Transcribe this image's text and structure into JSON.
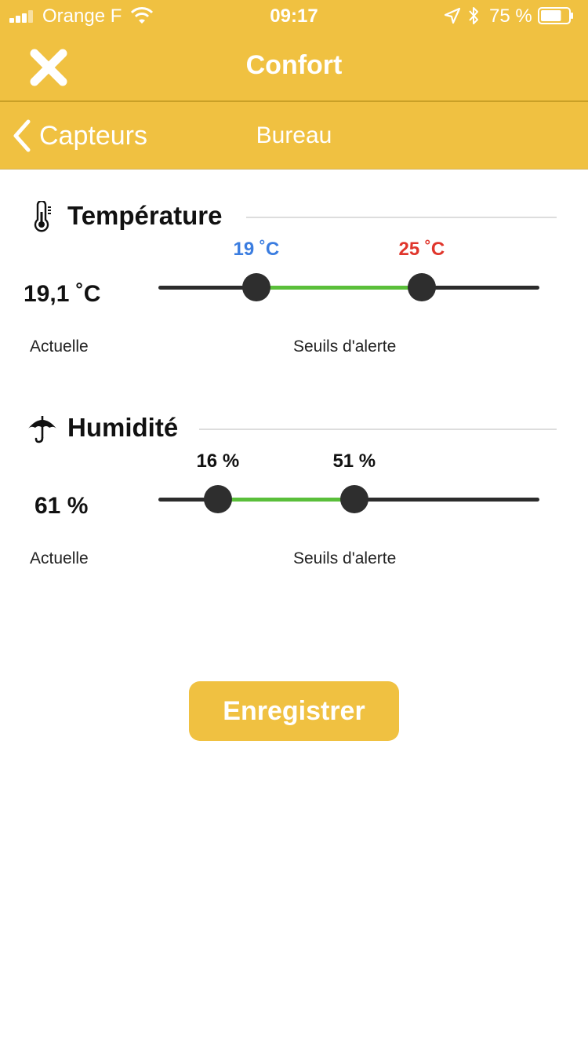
{
  "status_bar": {
    "carrier": "Orange F",
    "time": "09:17",
    "battery_percent": "75 %",
    "battery_level": 0.75
  },
  "header": {
    "title": "Confort",
    "close_icon": "close-icon"
  },
  "subheader": {
    "back_label": "Capteurs",
    "title": "Bureau"
  },
  "temperature": {
    "title": "Température",
    "icon": "thermometer-icon",
    "current_value": "19,1 ˚C",
    "current_label": "Actuelle",
    "thresholds_label": "Seuils d'alerte",
    "slider": {
      "min_value": 19,
      "max_value": 25,
      "min_label": "19 ˚C",
      "max_label": "25 ˚C",
      "min_fraction": 0.257,
      "max_fraction": 0.691,
      "min_color": "#3b7de0",
      "max_color": "#e0362c"
    }
  },
  "humidity": {
    "title": "Humidité",
    "icon": "umbrella-icon",
    "current_value": "61 %",
    "current_label": "Actuelle",
    "thresholds_label": "Seuils d'alerte",
    "slider": {
      "min_value": 16,
      "max_value": 51,
      "min_label": "16 %",
      "max_label": "51 %",
      "min_fraction": 0.156,
      "max_fraction": 0.514,
      "min_color": "#111111",
      "max_color": "#111111"
    }
  },
  "actions": {
    "save_label": "Enregistrer"
  },
  "colors": {
    "brand_yellow": "#f0c141",
    "range_green": "#5abf3a",
    "track_dark": "#2c2c2c"
  }
}
